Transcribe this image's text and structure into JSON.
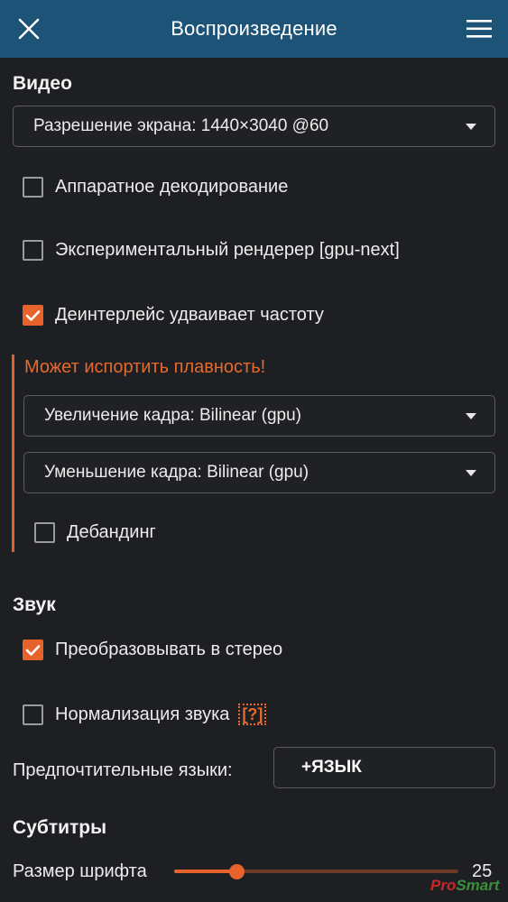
{
  "header": {
    "title": "Воспроизведение",
    "close_icon": "close-icon",
    "menu_icon": "hamburger-menu-icon"
  },
  "video": {
    "title": "Видео",
    "resolution_select": "Разрешение экрана: 1440×3040 @60",
    "hw_decoding": {
      "label": "Аппаратное декодирование",
      "checked": false
    },
    "gpu_next": {
      "label": "Экспериментальный рендерер [gpu-next]",
      "checked": false
    },
    "deinterlace": {
      "label": "Деинтерлейс удваивает частоту",
      "checked": true
    },
    "warning": "Может испортить плавность!",
    "upscale_select": "Увеличение кадра: Bilinear (gpu)",
    "downscale_select": "Уменьшение кадра: Bilinear (gpu)",
    "debanding": {
      "label": "Дебандинг",
      "checked": false
    }
  },
  "audio": {
    "title": "Звук",
    "stereo": {
      "label": "Преобразовывать в стерео",
      "checked": true
    },
    "normalize": {
      "label": "Нормализация звука",
      "checked": false,
      "help": "[?]"
    },
    "pref_lang_label": "Предпочтительные языки:",
    "add_lang_button": "+ЯЗЫК"
  },
  "subtitles": {
    "title": "Субтитры",
    "font_size_label": "Размер шрифта",
    "font_size_value": "25",
    "font_size_fraction": 0.22
  },
  "watermark": {
    "part1": "Pro",
    "part2": "Smart"
  },
  "colors": {
    "accent": "#e8632c",
    "header_bg": "#1c5377",
    "background": "#1e1f22"
  }
}
